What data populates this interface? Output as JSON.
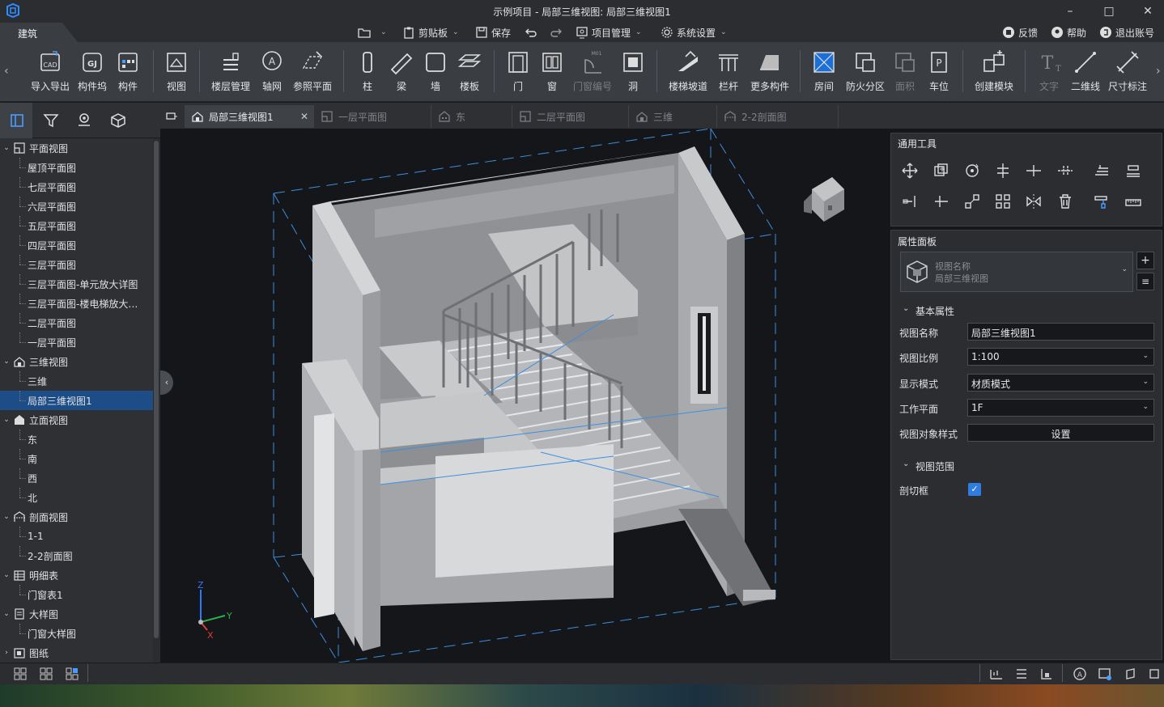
{
  "window": {
    "title": "示例项目 - 局部三维视图: 局部三维视图1",
    "minimize": "–",
    "maximize": "□",
    "close": "✕"
  },
  "menu": {
    "ribbon_tab": "建筑",
    "open_chevron": "⌄",
    "clipboard": "剪贴板",
    "save": "保存",
    "project_manage": "项目管理",
    "system_settings": "系统设置",
    "feedback": "反馈",
    "help": "帮助",
    "logout": "退出账号"
  },
  "ribbon": {
    "left_arrow": "‹",
    "right_arrow": "›",
    "buttons": [
      {
        "label": "导入导出",
        "icon": "cad-import-icon"
      },
      {
        "label": "构件坞",
        "icon": "component-dock-icon"
      },
      {
        "label": "构件",
        "icon": "component-icon"
      },
      {
        "label": "视图",
        "icon": "view-icon"
      },
      {
        "label": "楼层管理",
        "icon": "floor-manage-icon"
      },
      {
        "label": "轴网",
        "icon": "axis-grid-icon"
      },
      {
        "label": "参照平面",
        "icon": "ref-plane-icon"
      },
      {
        "label": "柱",
        "icon": "column-icon"
      },
      {
        "label": "梁",
        "icon": "beam-icon"
      },
      {
        "label": "墙",
        "icon": "wall-icon"
      },
      {
        "label": "楼板",
        "icon": "slab-icon"
      },
      {
        "label": "门",
        "icon": "door-icon"
      },
      {
        "label": "窗",
        "icon": "window-icon"
      },
      {
        "label": "门窗编号",
        "icon": "door-window-number-icon"
      },
      {
        "label": "洞",
        "icon": "opening-icon"
      },
      {
        "label": "楼梯坡道",
        "icon": "stair-ramp-icon"
      },
      {
        "label": "栏杆",
        "icon": "railing-icon"
      },
      {
        "label": "更多构件",
        "icon": "more-components-icon"
      },
      {
        "label": "房间",
        "icon": "room-icon"
      },
      {
        "label": "防火分区",
        "icon": "fire-zone-icon"
      },
      {
        "label": "面积",
        "icon": "area-icon"
      },
      {
        "label": "车位",
        "icon": "parking-icon"
      },
      {
        "label": "创建模块",
        "icon": "create-module-icon"
      },
      {
        "label": "文字",
        "icon": "text-icon"
      },
      {
        "label": "二维线",
        "icon": "line-2d-icon"
      },
      {
        "label": "尺寸标注",
        "icon": "dimension-icon"
      }
    ],
    "door_window_tag": "M01"
  },
  "tree": {
    "items": [
      {
        "label": "平面视图",
        "type": "group",
        "icon": "plan-view-icon"
      },
      {
        "label": "屋顶平面图",
        "type": "leaf"
      },
      {
        "label": "七层平面图",
        "type": "leaf"
      },
      {
        "label": "六层平面图",
        "type": "leaf"
      },
      {
        "label": "五层平面图",
        "type": "leaf"
      },
      {
        "label": "四层平面图",
        "type": "leaf"
      },
      {
        "label": "三层平面图",
        "type": "leaf"
      },
      {
        "label": "三层平面图-单元放大详图",
        "type": "leaf"
      },
      {
        "label": "三层平面图-楼电梯放大…",
        "type": "leaf"
      },
      {
        "label": "二层平面图",
        "type": "leaf"
      },
      {
        "label": "一层平面图",
        "type": "leaf"
      },
      {
        "label": "三维视图",
        "type": "group",
        "icon": "3d-view-icon"
      },
      {
        "label": "三维",
        "type": "leaf"
      },
      {
        "label": "局部三维视图1",
        "type": "leaf",
        "selected": true
      },
      {
        "label": "立面视图",
        "type": "group",
        "icon": "elevation-view-icon"
      },
      {
        "label": "东",
        "type": "leaf"
      },
      {
        "label": "南",
        "type": "leaf"
      },
      {
        "label": "西",
        "type": "leaf"
      },
      {
        "label": "北",
        "type": "leaf"
      },
      {
        "label": "剖面视图",
        "type": "group",
        "icon": "section-view-icon"
      },
      {
        "label": "1-1",
        "type": "leaf"
      },
      {
        "label": "2-2剖面图",
        "type": "leaf"
      },
      {
        "label": "明细表",
        "type": "group",
        "icon": "schedule-icon"
      },
      {
        "label": "门窗表1",
        "type": "leaf"
      },
      {
        "label": "大样图",
        "type": "group",
        "icon": "detail-icon"
      },
      {
        "label": "门窗大样图",
        "type": "leaf"
      },
      {
        "label": "图纸",
        "type": "group-collapsed",
        "icon": "sheet-icon"
      }
    ]
  },
  "tabs": [
    {
      "label": "局部三维视图1",
      "active": true,
      "icon": "3d-view-icon"
    },
    {
      "label": "一层平面图",
      "active": false,
      "icon": "plan-view-icon"
    },
    {
      "label": "东",
      "active": false,
      "icon": "elevation-view-icon"
    },
    {
      "label": "二层平面图",
      "active": false,
      "icon": "plan-view-icon"
    },
    {
      "label": "三维",
      "active": false,
      "icon": "3d-view-icon"
    },
    {
      "label": "2-2剖面图",
      "active": false,
      "icon": "section-view-icon"
    }
  ],
  "viewport": {
    "axis_x": "X",
    "axis_y": "Y",
    "axis_z": "Z"
  },
  "tools_panel": {
    "title": "通用工具"
  },
  "props_panel": {
    "title": "属性面板",
    "type_name_label": "视图名称",
    "type_name_value": "局部三维视图",
    "section_basic": "基本属性",
    "section_range": "视图范围",
    "rows": {
      "view_name_label": "视图名称",
      "view_name_value": "局部三维视图1",
      "scale_label": "视图比例",
      "scale_value": "1:100",
      "display_label": "显示模式",
      "display_value": "材质模式",
      "workplane_label": "工作平面",
      "workplane_value": "1F",
      "style_label": "视图对象样式",
      "style_button": "设置",
      "cutbox_label": "剖切框",
      "cutbox_checked": true
    }
  },
  "colors": {
    "accent": "#1d6fd8",
    "selected_row": "#1d4d86",
    "panel_bg": "#2b2d31"
  }
}
